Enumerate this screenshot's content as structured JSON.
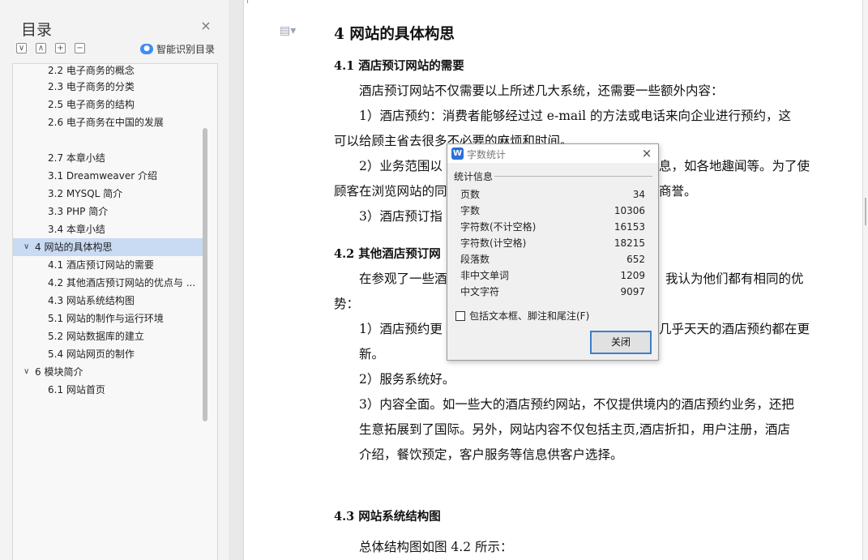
{
  "nav": {
    "title": "目录",
    "close_glyph": "×",
    "tools": [
      "∨",
      "∧",
      "+",
      "−"
    ],
    "smart_label": "智能识别目录",
    "items": [
      {
        "label": "2.2  电子商务的概念",
        "indent": 1
      },
      {
        "label": "2.3  电子商务的分类",
        "indent": 1
      },
      {
        "label": "2.5  电子商务的结构",
        "indent": 1
      },
      {
        "label": "2.6  电子商务在中国的发展",
        "indent": 1
      },
      {
        "label": "",
        "indent": 1
      },
      {
        "label": "2.7  本章小结",
        "indent": 1
      },
      {
        "label": "3.1    Dreamweaver 介绍",
        "indent": 1
      },
      {
        "label": "3.2    MYSQL 简介",
        "indent": 1
      },
      {
        "label": "3.3 PHP 简介",
        "indent": 1
      },
      {
        "label": "3.4  本章小结",
        "indent": 1
      },
      {
        "label": "4    网站的具体构思",
        "indent": 0,
        "expanded": true,
        "active": true
      },
      {
        "label": "4.1  酒店预订网站的需要",
        "indent": 1
      },
      {
        "label": "4.2  其他酒店预订网站的优点与 ...",
        "indent": 1
      },
      {
        "label": "4.3  网站系统结构图",
        "indent": 1
      },
      {
        "label": "5.1  网站的制作与运行环境",
        "indent": 1
      },
      {
        "label": "5.2  网站数据库的建立",
        "indent": 1
      },
      {
        "label": "5.4  网站网页的制作",
        "indent": 1
      },
      {
        "label": "6  模块简介",
        "indent": 0,
        "expanded": true
      },
      {
        "label": "6.1  网站首页",
        "indent": 1
      }
    ]
  },
  "doc": {
    "lines": [
      {
        "text": "4   网站的具体构思",
        "style": "h1"
      },
      {
        "text": "4.1  酒店预订网站的需要",
        "style": "h2"
      },
      {
        "text": "酒店预订网站不仅需要以上所述几大系统，还需要一些额外内容：",
        "style": "p"
      },
      {
        "text": "1）酒店预约：消费者能够经过过 e-mail 的方法或电话来向企业进行预约，这",
        "style": "p"
      },
      {
        "text": "可以给顾主省去很多不必要的麻烦和时间。",
        "style": "p"
      },
      {
        "text": "2）业务范围以",
        "style": "p"
      },
      {
        "text": "息，如各地趣闻等。为了使",
        "style": "p"
      },
      {
        "text": "顾客在浏览网站的同",
        "style": "p"
      },
      {
        "text": "商誉。",
        "style": "p"
      },
      {
        "text": "3）酒店预订指",
        "style": "p"
      },
      {
        "text": "4.2  其他酒店预订网",
        "style": "h2"
      },
      {
        "text": "在参观了一些酒",
        "style": "p"
      },
      {
        "text": "我认为他们都有相同的优",
        "style": "p"
      },
      {
        "text": "势：",
        "style": "p"
      },
      {
        "text": "1）酒店预约更",
        "style": "p"
      },
      {
        "text": "几乎天天的酒店预约都在更",
        "style": "p"
      },
      {
        "text": "新。",
        "style": "p"
      },
      {
        "text": "2）服务系统好。",
        "style": "p"
      },
      {
        "text": "3）内容全面。如一些大的酒店预约网站，不仅提供境内的酒店预约业务，还把",
        "style": "p"
      },
      {
        "text": "生意拓展到了国际。另外，网站内容不仅包括主页,酒店折扣，用户注册，酒店",
        "style": "p"
      },
      {
        "text": "介绍，餐饮预定，客户服务等信息供客户选择。",
        "style": "p"
      },
      {
        "text": "4.3  网站系统结构图",
        "style": "h2"
      },
      {
        "text": "总体结构图如图 4.2 所示：",
        "style": "p"
      }
    ]
  },
  "dialog": {
    "title": "字数统计",
    "logo": "W",
    "close_glyph": "×",
    "section": "统计信息",
    "stats": [
      {
        "label": "页数",
        "value": "34"
      },
      {
        "label": "字数",
        "value": "10306"
      },
      {
        "label": "字符数(不计空格)",
        "value": "16153"
      },
      {
        "label": "字符数(计空格)",
        "value": "18215"
      },
      {
        "label": "段落数",
        "value": "652"
      },
      {
        "label": "非中文单词",
        "value": "1209"
      },
      {
        "label": "中文字符",
        "value": "9097"
      }
    ],
    "checkbox_label": "包括文本框、脚注和尾注(F)",
    "checkbox_checked": false,
    "close_button": "关闭"
  }
}
